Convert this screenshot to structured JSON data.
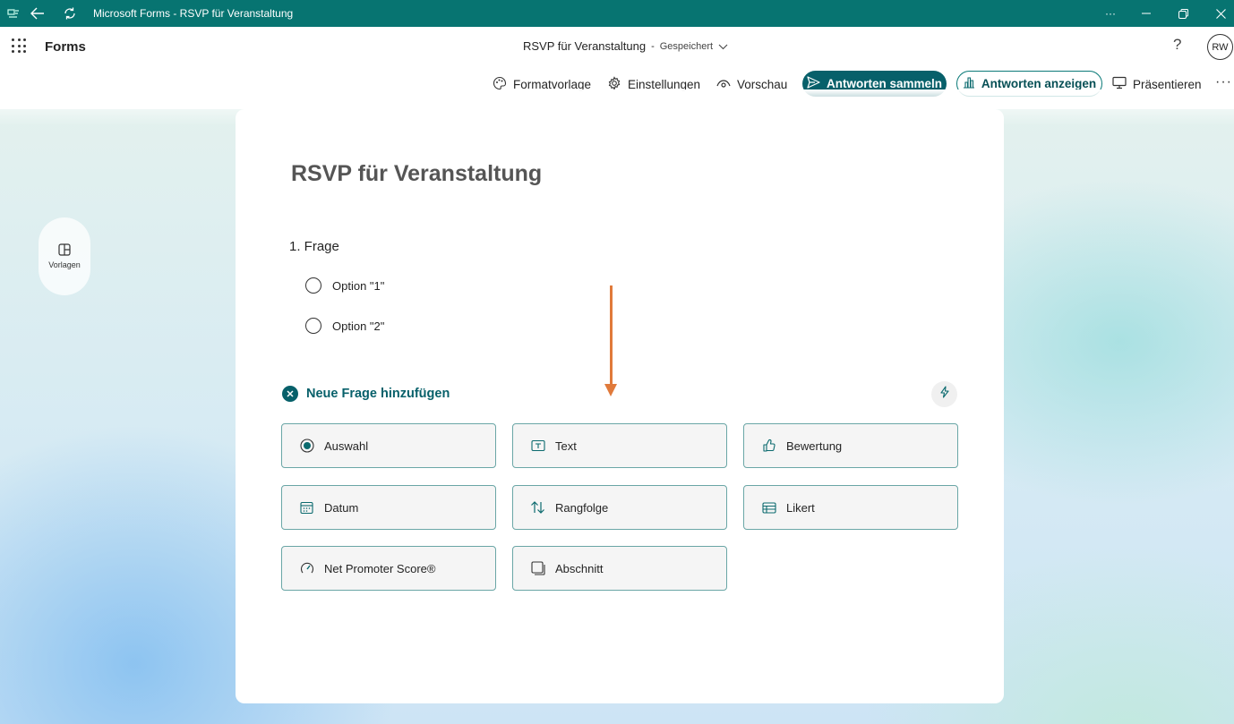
{
  "window": {
    "title": "Microsoft Forms - RSVP für Veranstaltung",
    "more_label": "···"
  },
  "header": {
    "brand": "Forms",
    "doc_title": "RSVP für Veranstaltung",
    "separator": "-",
    "saved_label": "Gespeichert",
    "help_label": "?",
    "avatar_initials": "RW"
  },
  "toolbar": {
    "style": "Formatvorlage",
    "settings": "Einstellungen",
    "preview": "Vorschau",
    "collect": "Antworten sammeln",
    "view_responses": "Antworten anzeigen",
    "present": "Präsentieren",
    "more": "···"
  },
  "sidebar": {
    "templates_label": "Vorlagen"
  },
  "form": {
    "title": "RSVP für Veranstaltung",
    "question_label": "1. Frage",
    "options": [
      "Option \"1\"",
      "Option \"2\""
    ],
    "add_question_label": "Neue Frage hinzufügen"
  },
  "question_types": [
    {
      "label": "Auswahl",
      "icon": "radio-choice-icon"
    },
    {
      "label": "Text",
      "icon": "text-box-icon"
    },
    {
      "label": "Bewertung",
      "icon": "thumbs-up-icon"
    },
    {
      "label": "Datum",
      "icon": "calendar-icon"
    },
    {
      "label": "Rangfolge",
      "icon": "ranking-arrows-icon"
    },
    {
      "label": "Likert",
      "icon": "likert-grid-icon"
    },
    {
      "label": "Net Promoter Score®",
      "icon": "gauge-icon"
    },
    {
      "label": "Abschnitt",
      "icon": "section-icon"
    }
  ],
  "colors": {
    "titlebar": "#077471",
    "primary_button": "#07606a",
    "accent": "#07606a",
    "annotation_arrow": "#e07a3b"
  }
}
